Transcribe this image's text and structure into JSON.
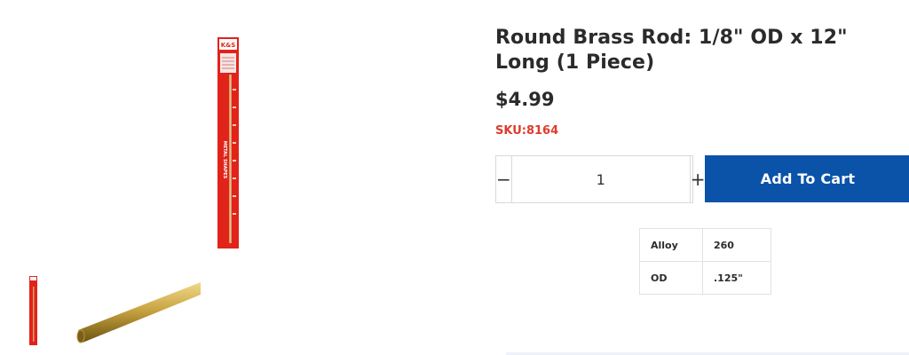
{
  "product": {
    "title": "Round Brass Rod: 1/8\" OD x 12\" Long (1 Piece)",
    "price": "$4.99",
    "sku": "SKU:8164"
  },
  "gallery": {
    "package_logo": "K&S",
    "package_label": "METAL SHAPES",
    "colors": {
      "package_red": "#e2231a",
      "brass": "#c9a542"
    }
  },
  "quantity": {
    "value": "1",
    "minus_label": "−",
    "plus_label": "+"
  },
  "cart": {
    "add_label": "Add To Cart",
    "button_color": "#0b53a8"
  },
  "specs": [
    {
      "key": "Alloy",
      "value": "260"
    },
    {
      "key": "OD",
      "value": ".125\""
    }
  ],
  "colors": {
    "sku": "#dd3c2c",
    "text": "#2b2b2b"
  }
}
